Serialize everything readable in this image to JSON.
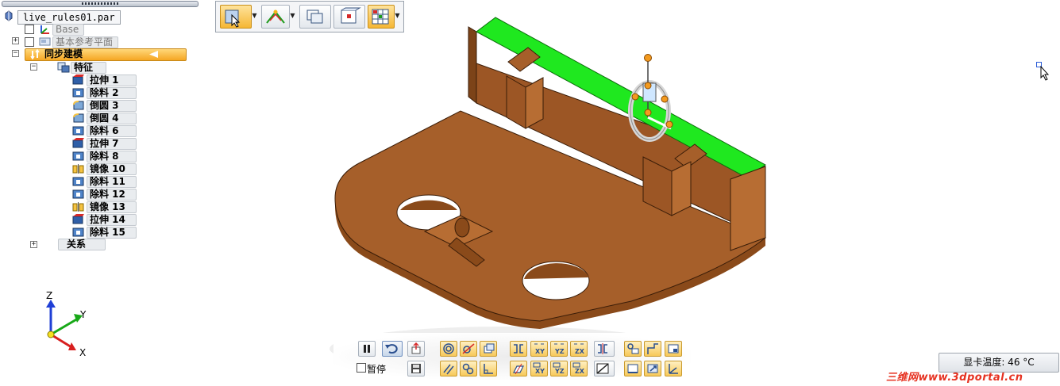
{
  "pathfinder": {
    "file_name": "live_rules01.par",
    "base_label": "Base",
    "ref_planes_label": "基本参考平面",
    "sync_label": "同步建模",
    "features_label": "特征",
    "features": [
      {
        "label": "拉伸 1",
        "icon": "extrude-icon"
      },
      {
        "label": "除料 2",
        "icon": "cutout-icon"
      },
      {
        "label": "倒圆 3",
        "icon": "round-icon"
      },
      {
        "label": "倒圆 4",
        "icon": "round-icon"
      },
      {
        "label": "除料 6",
        "icon": "cutout-icon"
      },
      {
        "label": "拉伸 7",
        "icon": "extrude-icon"
      },
      {
        "label": "除料 8",
        "icon": "cutout-icon"
      },
      {
        "label": "镜像 10",
        "icon": "mirror-icon"
      },
      {
        "label": "除料 11",
        "icon": "cutout-icon"
      },
      {
        "label": "除料 12",
        "icon": "cutout-icon"
      },
      {
        "label": "镜像 13",
        "icon": "mirror-icon"
      },
      {
        "label": "拉伸 14",
        "icon": "extrude-icon"
      },
      {
        "label": "除料 15",
        "icon": "cutout-icon"
      }
    ],
    "relations_label": "关系"
  },
  "triad": {
    "z": "Z",
    "y": "Y",
    "x": "X"
  },
  "bottom_bar": {
    "pause_label": "暂停"
  },
  "status": {
    "gpu_temp": "显卡温度: 46 °C"
  },
  "watermark": "三维网www.3dportal.cn",
  "colors": {
    "part_body": "#a65f2a",
    "part_top": "#9c5625",
    "face_highlight": "#1fe81f",
    "selected_node": "#f5a623"
  }
}
